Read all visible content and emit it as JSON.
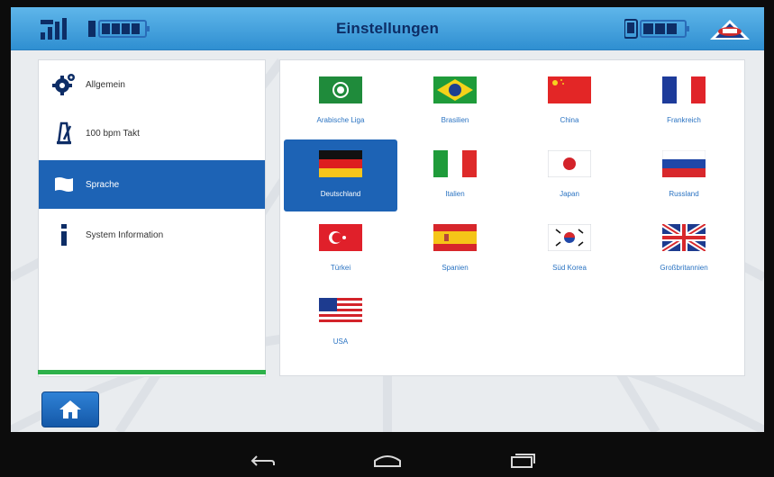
{
  "header": {
    "title": "Einstellungen",
    "icons": [
      "signal-icon",
      "battery-icon",
      "tablet-battery-icon",
      "brand-logo"
    ]
  },
  "menu": {
    "items": [
      {
        "label": "Allgemein",
        "icon": "gear-icon"
      },
      {
        "label": "100 bpm Takt",
        "icon": "metronome-icon"
      },
      {
        "label": "Sprache",
        "icon": "flag-icon",
        "active": true
      },
      {
        "label": "System Information",
        "icon": "info-icon"
      }
    ]
  },
  "languages": [
    {
      "label": "Arabische Liga",
      "flag": "arab-league"
    },
    {
      "label": "Brasilien",
      "flag": "brazil"
    },
    {
      "label": "China",
      "flag": "china"
    },
    {
      "label": "Frankreich",
      "flag": "france"
    },
    {
      "label": "Deutschland",
      "flag": "germany",
      "selected": true
    },
    {
      "label": "Italien",
      "flag": "italy"
    },
    {
      "label": "Japan",
      "flag": "japan"
    },
    {
      "label": "Russland",
      "flag": "russia"
    },
    {
      "label": "Türkei",
      "flag": "turkey"
    },
    {
      "label": "Spanien",
      "flag": "spain"
    },
    {
      "label": "Süd Korea",
      "flag": "south-korea"
    },
    {
      "label": "Großbritannien",
      "flag": "united-kingdom"
    },
    {
      "label": "USA",
      "flag": "usa"
    }
  ],
  "colors": {
    "header_top": "#5fb6ea",
    "header_bottom": "#2f8fd1",
    "title": "#0d2d66",
    "accent": "#1d63b5",
    "progress": "#2db14a",
    "label": "#2a73c2"
  },
  "navbar": {
    "buttons": [
      "back-icon",
      "home-nav-icon",
      "recents-icon"
    ]
  }
}
